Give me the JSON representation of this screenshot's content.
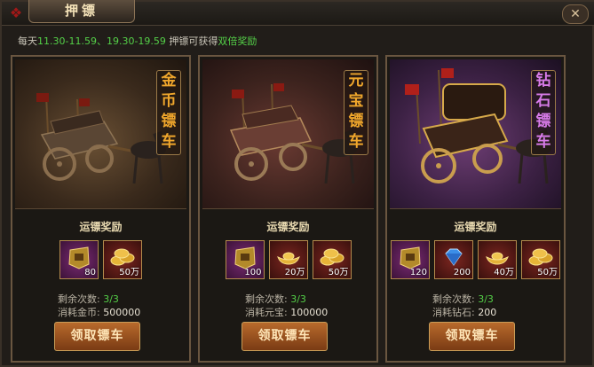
{
  "window": {
    "title": "押镖",
    "close_glyph": "✕"
  },
  "notice": {
    "prefix": "每天",
    "times": "11.30-11.59、19.30-19.59",
    "middle": " 押镖可获得",
    "highlight": "双倍奖励"
  },
  "carts": [
    {
      "name_chars": [
        "金",
        "币",
        "镖",
        "车"
      ],
      "reward_label": "运镖奖励",
      "rewards": [
        {
          "icon": "gold-badge-icon",
          "qty": "80",
          "bg": "purple"
        },
        {
          "icon": "gold-coins-icon",
          "qty": "50万",
          "bg": "red"
        }
      ],
      "remaining_label": "剩余次数:",
      "remaining_value": "3/3",
      "cost_label": "消耗金币:",
      "cost_value": "500000",
      "button_label": "领取镖车"
    },
    {
      "name_chars": [
        "元",
        "宝",
        "镖",
        "车"
      ],
      "reward_label": "运镖奖励",
      "rewards": [
        {
          "icon": "gold-badge-icon",
          "qty": "100",
          "bg": "purple"
        },
        {
          "icon": "gold-ingot-icon",
          "qty": "20万",
          "bg": "red"
        },
        {
          "icon": "gold-coins-icon",
          "qty": "50万",
          "bg": "red"
        }
      ],
      "remaining_label": "剩余次数:",
      "remaining_value": "3/3",
      "cost_label": "消耗元宝:",
      "cost_value": "100000",
      "button_label": "领取镖车"
    },
    {
      "name_chars": [
        "钻",
        "石",
        "镖",
        "车"
      ],
      "reward_label": "运镖奖励",
      "rewards": [
        {
          "icon": "gold-badge-icon",
          "qty": "120",
          "bg": "purple"
        },
        {
          "icon": "diamond-icon",
          "qty": "200",
          "bg": "red"
        },
        {
          "icon": "gold-ingot-icon",
          "qty": "40万",
          "bg": "red"
        },
        {
          "icon": "gold-coins-icon",
          "qty": "50万",
          "bg": "red"
        }
      ],
      "remaining_label": "剩余次数:",
      "remaining_value": "3/3",
      "cost_label": "消耗钻石:",
      "cost_value": "200",
      "button_label": "领取镖车"
    }
  ]
}
